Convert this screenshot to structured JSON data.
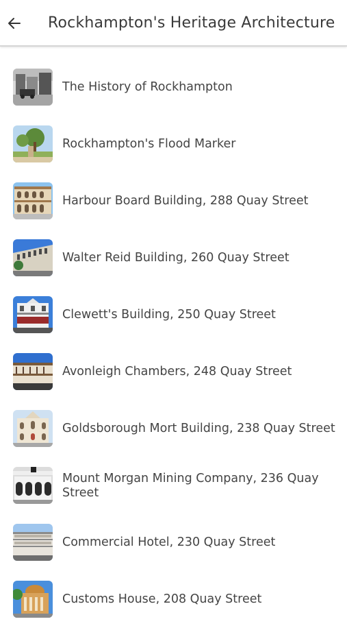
{
  "header": {
    "title": "Rockhampton's Heritage Architecture",
    "back_icon": "arrow-left-icon"
  },
  "items": [
    {
      "label": "The History of Rockhampton"
    },
    {
      "label": "Rockhampton's Flood Marker"
    },
    {
      "label": "Harbour Board Building, 288 Quay Street"
    },
    {
      "label": "Walter Reid Building, 260 Quay Street"
    },
    {
      "label": "Clewett's Building, 250 Quay Street"
    },
    {
      "label": "Avonleigh Chambers, 248 Quay Street"
    },
    {
      "label": "Goldsborough Mort Building, 238 Quay Street"
    },
    {
      "label": "Mount Morgan Mining Company, 236 Quay Street"
    },
    {
      "label": "Commercial Hotel, 230 Quay Street"
    },
    {
      "label": "Customs House, 208 Quay Street"
    }
  ]
}
